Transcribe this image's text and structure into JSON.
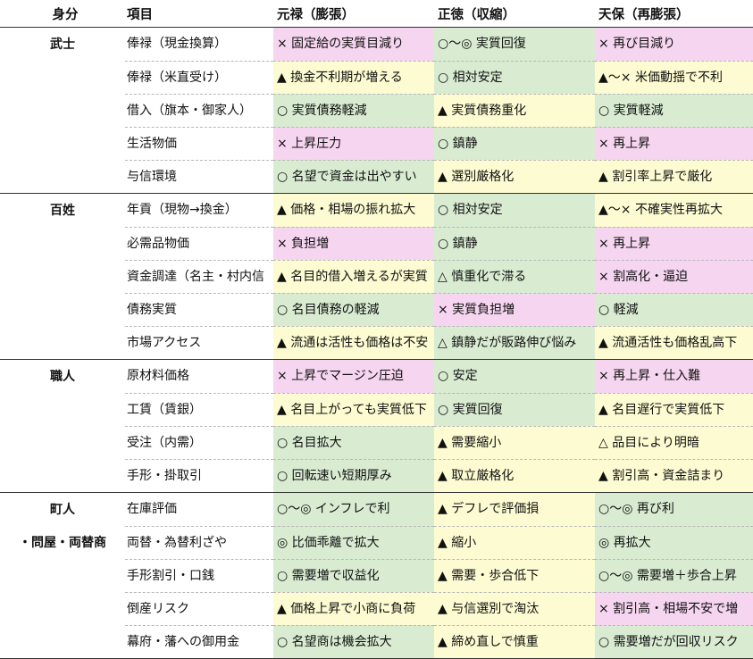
{
  "headers": {
    "class": "身分",
    "item": "項目",
    "p1": "元禄（膨張）",
    "p2": "正徳（収縮）",
    "p3": "天保（再膨張）"
  },
  "colors": {
    "green": "#d9ecd2",
    "yellow": "#fcfbd1",
    "pink": "#f6d5f0"
  },
  "groups": [
    {
      "lines": [
        "武士"
      ],
      "rows": [
        {
          "item": "俸禄（現金換算）",
          "p1": {
            "text": "× 固定給の実質目減り",
            "bg": "pink"
          },
          "p2": {
            "text": "○〜◎ 実質回復",
            "bg": "green"
          },
          "p3": {
            "text": "× 再び目減り",
            "bg": "pink"
          }
        },
        {
          "item": "俸禄（米直受け）",
          "p1": {
            "text": "▲ 換金不利期が増える",
            "bg": "yellow"
          },
          "p2": {
            "text": "○ 相対安定",
            "bg": "green"
          },
          "p3": {
            "text": "▲〜× 米価動揺で不利",
            "bg": "yellow"
          }
        },
        {
          "item": "借入（旗本・御家人）",
          "p1": {
            "text": "○ 実質債務軽減",
            "bg": "green"
          },
          "p2": {
            "text": "▲ 実質債務重化",
            "bg": "yellow"
          },
          "p3": {
            "text": "○ 実質軽減",
            "bg": "green"
          }
        },
        {
          "item": "生活物価",
          "p1": {
            "text": "× 上昇圧力",
            "bg": "pink"
          },
          "p2": {
            "text": "○ 鎮静",
            "bg": "green"
          },
          "p3": {
            "text": "× 再上昇",
            "bg": "pink"
          }
        },
        {
          "item": "与信環境",
          "p1": {
            "text": "○ 名望で資金は出やすい",
            "bg": "green"
          },
          "p2": {
            "text": "▲ 選別厳格化",
            "bg": "yellow"
          },
          "p3": {
            "text": "▲ 割引率上昇で厳化",
            "bg": "yellow"
          }
        }
      ]
    },
    {
      "lines": [
        "百姓"
      ],
      "rows": [
        {
          "item": "年貢（現物→換金）",
          "p1": {
            "text": "▲ 価格・相場の振れ拡大",
            "bg": "yellow"
          },
          "p2": {
            "text": "○ 相対安定",
            "bg": "green"
          },
          "p3": {
            "text": "▲〜× 不確実性再拡大",
            "bg": "yellow"
          }
        },
        {
          "item": "必需品物価",
          "p1": {
            "text": "× 負担増",
            "bg": "pink"
          },
          "p2": {
            "text": "○ 鎮静",
            "bg": "green"
          },
          "p3": {
            "text": "× 再上昇",
            "bg": "pink"
          }
        },
        {
          "item": "資金調達（名主・村内信",
          "p1": {
            "text": "▲ 名目的借入増えるが実質",
            "bg": "yellow"
          },
          "p2": {
            "text": "△ 慎重化で滞る",
            "bg": "green"
          },
          "p3": {
            "text": "× 割高化・逼迫",
            "bg": "pink"
          }
        },
        {
          "item": "債務実質",
          "p1": {
            "text": "○ 名目債務の軽減",
            "bg": "green"
          },
          "p2": {
            "text": "× 実質負担増",
            "bg": "pink"
          },
          "p3": {
            "text": "○ 軽減",
            "bg": "green"
          }
        },
        {
          "item": "市場アクセス",
          "p1": {
            "text": "▲ 流通は活性も価格は不安",
            "bg": "yellow"
          },
          "p2": {
            "text": "△ 鎮静だが販路伸び悩み",
            "bg": "green"
          },
          "p3": {
            "text": "▲ 流通活性も価格乱高下",
            "bg": "yellow"
          }
        }
      ]
    },
    {
      "lines": [
        "職人"
      ],
      "rows": [
        {
          "item": "原材料価格",
          "p1": {
            "text": "× 上昇でマージン圧迫",
            "bg": "pink"
          },
          "p2": {
            "text": "○ 安定",
            "bg": "green"
          },
          "p3": {
            "text": "× 再上昇・仕入難",
            "bg": "pink"
          }
        },
        {
          "item": "工賃（賃銀）",
          "p1": {
            "text": "▲ 名目上がっても実質低下",
            "bg": "yellow"
          },
          "p2": {
            "text": "○ 実質回復",
            "bg": "green"
          },
          "p3": {
            "text": "▲ 名目遅行で実質低下",
            "bg": "yellow"
          }
        },
        {
          "item": "受注（内需）",
          "p1": {
            "text": "○ 名目拡大",
            "bg": "green"
          },
          "p2": {
            "text": "▲ 需要縮小",
            "bg": "yellow"
          },
          "p3": {
            "text": "△ 品目により明暗",
            "bg": "yellow"
          }
        },
        {
          "item": "手形・掛取引",
          "p1": {
            "text": "○ 回転速い短期厚み",
            "bg": "green"
          },
          "p2": {
            "text": "▲ 取立厳格化",
            "bg": "yellow"
          },
          "p3": {
            "text": "▲ 割引高・資金詰まり",
            "bg": "yellow"
          }
        }
      ]
    },
    {
      "lines": [
        "町人",
        "・問屋・両替商"
      ],
      "rows": [
        {
          "item": "在庫評価",
          "p1": {
            "text": "○〜◎ インフレで利",
            "bg": "green"
          },
          "p2": {
            "text": "▲ デフレで評価損",
            "bg": "yellow"
          },
          "p3": {
            "text": "○〜◎ 再び利",
            "bg": "green"
          }
        },
        {
          "item": "両替・為替利ざや",
          "p1": {
            "text": "◎ 比価乖離で拡大",
            "bg": "green"
          },
          "p2": {
            "text": "▲ 縮小",
            "bg": "yellow"
          },
          "p3": {
            "text": "◎ 再拡大",
            "bg": "green"
          }
        },
        {
          "item": "手形割引・口銭",
          "p1": {
            "text": "○ 需要増で収益化",
            "bg": "green"
          },
          "p2": {
            "text": "▲ 需要・歩合低下",
            "bg": "yellow"
          },
          "p3": {
            "text": "○〜◎ 需要増＋歩合上昇",
            "bg": "green"
          }
        },
        {
          "item": "倒産リスク",
          "p1": {
            "text": "▲ 価格上昇で小商に負荷",
            "bg": "yellow"
          },
          "p2": {
            "text": "▲ 与信選別で淘汰",
            "bg": "yellow"
          },
          "p3": {
            "text": "× 割引高・相場不安で増",
            "bg": "pink"
          }
        },
        {
          "item": "幕府・藩への御用金",
          "p1": {
            "text": "○ 名望商は機会拡大",
            "bg": "green"
          },
          "p2": {
            "text": "▲ 締め直しで慎重",
            "bg": "yellow"
          },
          "p3": {
            "text": "○ 需要増だが回収リスク",
            "bg": "green"
          }
        }
      ]
    }
  ]
}
